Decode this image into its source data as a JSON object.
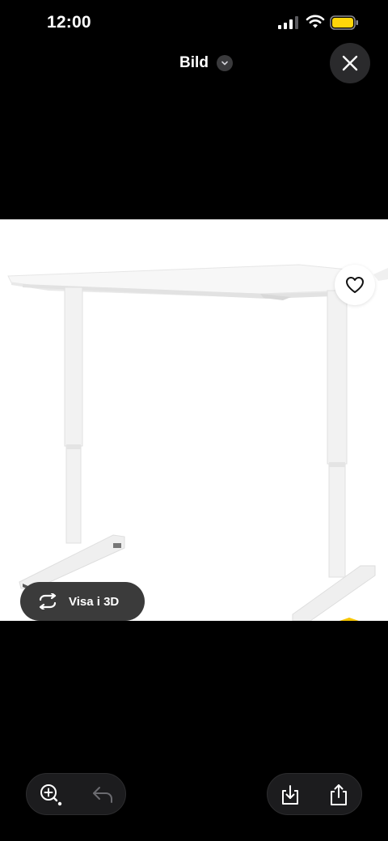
{
  "status_bar": {
    "time": "12:00",
    "icons": [
      "signal-icon",
      "wifi-icon",
      "battery-icon"
    ],
    "battery_color": "#FFD60A"
  },
  "header": {
    "title": "Bild",
    "dropdown_icon": "chevron-down-icon",
    "close_icon": "close-icon"
  },
  "image": {
    "subject": "height-adjustable white desk",
    "favorite_icon": "heart-icon",
    "view_3d": {
      "label": "Visa i 3D",
      "icon": "rotate-3d-icon"
    }
  },
  "toolbar": {
    "left": [
      "zoom-in-icon",
      "undo-icon"
    ],
    "right": [
      "save-icon",
      "share-icon"
    ]
  },
  "colors": {
    "background": "#000000",
    "button_bg": "#2a2a2c",
    "pill_bg": "#3b3b3b",
    "image_bg": "#ffffff"
  }
}
